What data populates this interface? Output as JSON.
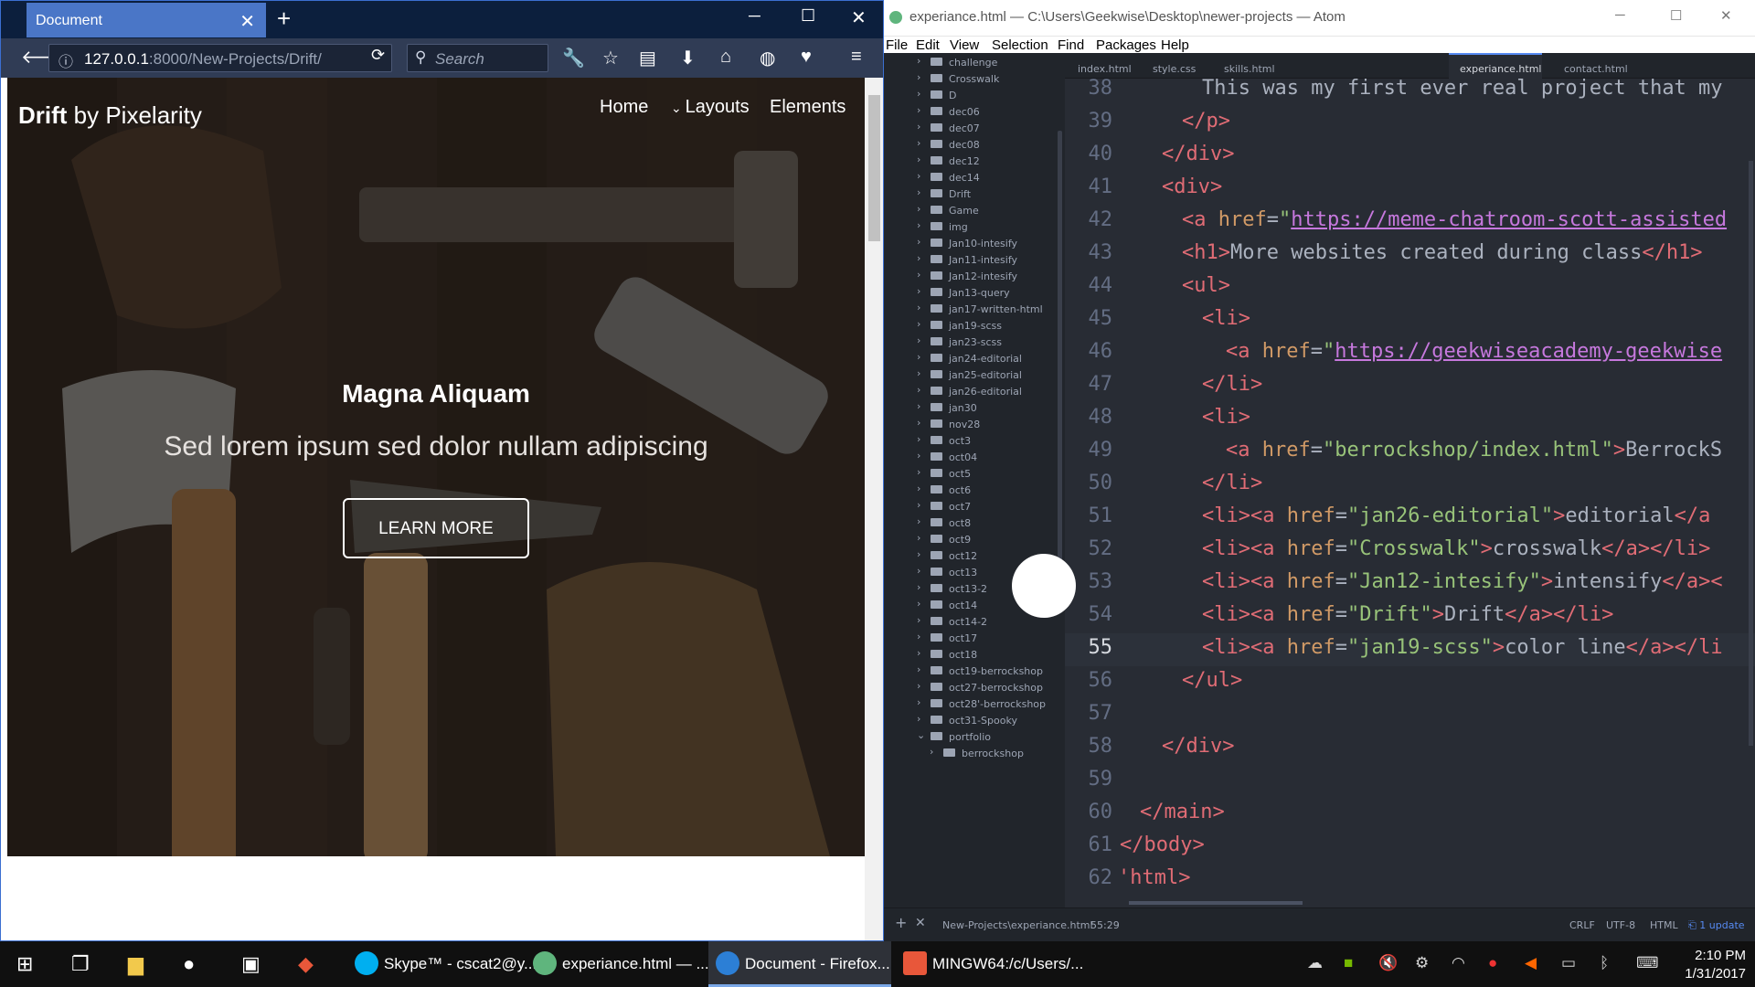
{
  "firefox": {
    "tab_title": "Document",
    "tab_close": "✕",
    "new_tab": "+",
    "url_host": "127.0.0.1",
    "url_rest": ":8000/New-Projects/Drift/",
    "search_placeholder": "Search",
    "page": {
      "brand_bold": "Drift",
      "brand_rest": " by Pixelarity",
      "nav": [
        "Home",
        "Layouts",
        "Elements"
      ],
      "title": "Magna Aliquam",
      "subtitle": "Sed lorem ipsum sed dolor nullam adipiscing",
      "button": "LEARN MORE"
    }
  },
  "atom": {
    "window_title": "experiance.html — C:\\Users\\Geekwise\\Desktop\\newer-projects — Atom",
    "menu": [
      "File",
      "Edit",
      "View",
      "Selection",
      "Find",
      "Packages",
      "Help"
    ],
    "tree": [
      "challenge",
      "Crosswalk",
      "D",
      "dec06",
      "dec07",
      "dec08",
      "dec12",
      "dec14",
      "Drift",
      "Game",
      "img",
      "Jan10-intesify",
      "Jan11-intesify",
      "Jan12-intesify",
      "Jan13-query",
      "jan17-written-html",
      "jan19-scss",
      "jan23-scss",
      "jan24-editorial",
      "jan25-editorial",
      "jan26-editorial",
      "jan30",
      "nov28",
      "oct3",
      "oct04",
      "oct5",
      "oct6",
      "oct7",
      "oct8",
      "oct9",
      "oct12",
      "oct13",
      "oct13-2",
      "oct14",
      "oct14-2",
      "oct17",
      "oct18",
      "oct19-berrockshop",
      "oct27-berrockshop",
      "oct28'-berrockshop",
      "oct31-Spooky",
      "portfolio",
      "berrockshop"
    ],
    "tabs": [
      "index.html",
      "style.css",
      "skills.html",
      "experiance.html",
      "contact.html"
    ],
    "line_numbers": [
      "38",
      "39",
      "40",
      "41",
      "42",
      "43",
      "44",
      "45",
      "46",
      "47",
      "48",
      "49",
      "50",
      "51",
      "52",
      "53",
      "54",
      "55",
      "56",
      "57",
      "58",
      "59",
      "60",
      "61",
      "62"
    ],
    "status": {
      "path": "New-Projects\\experiance.html",
      "cursor": "55:29",
      "eol": "CRLF",
      "encoding": "UTF-8",
      "grammar": "HTML",
      "update": "1 update"
    }
  },
  "taskbar": {
    "items": [
      "Skype™ - cscat2@y...",
      "experiance.html — ...",
      "Document - Firefox...",
      "MINGW64:/c/Users/..."
    ],
    "time": "2:10 PM",
    "date": "1/31/2017"
  }
}
